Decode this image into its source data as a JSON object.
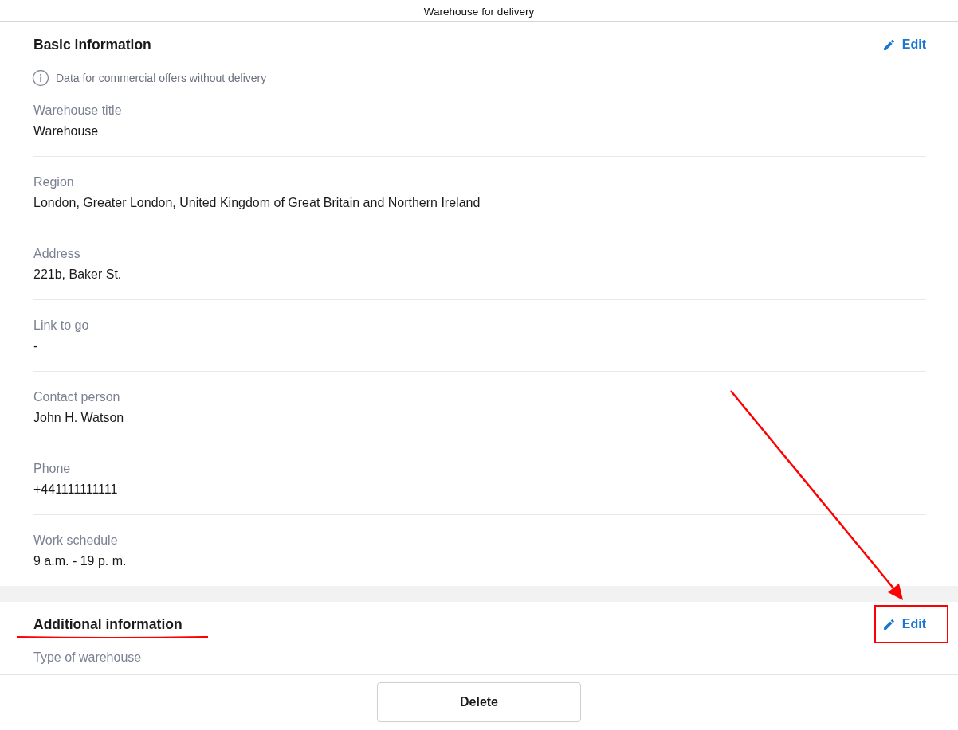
{
  "top_bar": {
    "title": "Warehouse for delivery"
  },
  "sections": [
    {
      "title": "Basic information",
      "edit_label": "Edit",
      "highlighted": false,
      "note": "Data for commercial offers without delivery",
      "fields": [
        {
          "label": "Warehouse title",
          "value": "Warehouse"
        },
        {
          "label": "Region",
          "value": "London, Greater London, United Kingdom of Great Britain and Northern Ireland"
        },
        {
          "label": "Address",
          "value": "221b, Baker St."
        },
        {
          "label": "Link to go",
          "value": "-"
        },
        {
          "label": "Contact person",
          "value": "John H. Watson"
        },
        {
          "label": "Phone",
          "value": "+441111111111"
        },
        {
          "label": "Work schedule",
          "value": "9 a.m. - 19 p. m."
        }
      ]
    },
    {
      "title": "Additional information",
      "edit_label": "Edit",
      "highlighted": true,
      "fields": [
        {
          "label": "Type of warehouse"
        }
      ]
    }
  ],
  "footer": {
    "delete_label": "Delete"
  }
}
